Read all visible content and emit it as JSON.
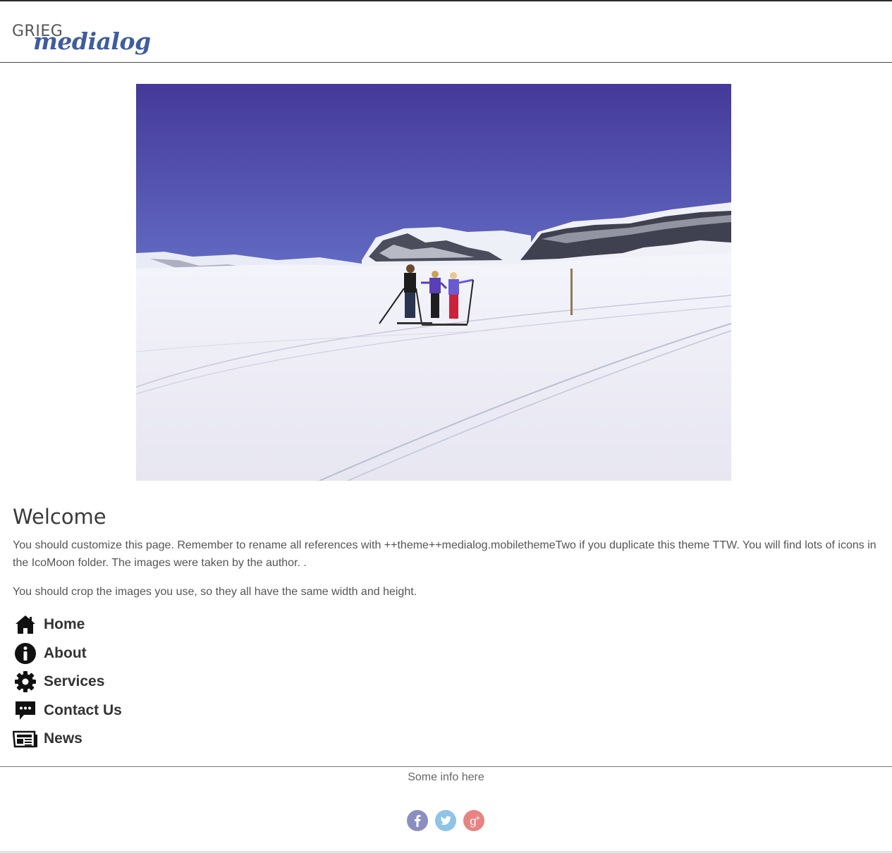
{
  "header": {
    "logo": {
      "line1": "GRIEG",
      "line2": "medialog"
    }
  },
  "hero": {
    "alt": "Three cross-country skiers on a snowy mountain plateau under a blue sky"
  },
  "content": {
    "title": "Welcome",
    "paragraph1": "You should customize this page. Remember to rename all references with ++theme++medialog.mobilethemeTwo if you duplicate this theme TTW. You will find lots of icons in the IcoMoon folder. The images were taken by the author. .",
    "paragraph2": "You should crop the images you use, so they all have the same width and height."
  },
  "menu": {
    "items": [
      {
        "label": "Home",
        "icon": "home-icon"
      },
      {
        "label": "About",
        "icon": "info-icon"
      },
      {
        "label": "Services",
        "icon": "gear-icon"
      },
      {
        "label": "Contact Us",
        "icon": "chat-bubble-icon"
      },
      {
        "label": "News",
        "icon": "newspaper-icon"
      }
    ]
  },
  "footer": {
    "info": "Some info here",
    "social": [
      {
        "name": "facebook",
        "glyph": "f",
        "color": "#8b8fbf"
      },
      {
        "name": "twitter",
        "glyph": "t",
        "color": "#8fc3e8"
      },
      {
        "name": "google-plus",
        "glyph": "g+",
        "color": "#e88383"
      }
    ]
  },
  "colors": {
    "brand_blue": "#3f5d9e",
    "text": "#333333",
    "muted": "#555555"
  }
}
